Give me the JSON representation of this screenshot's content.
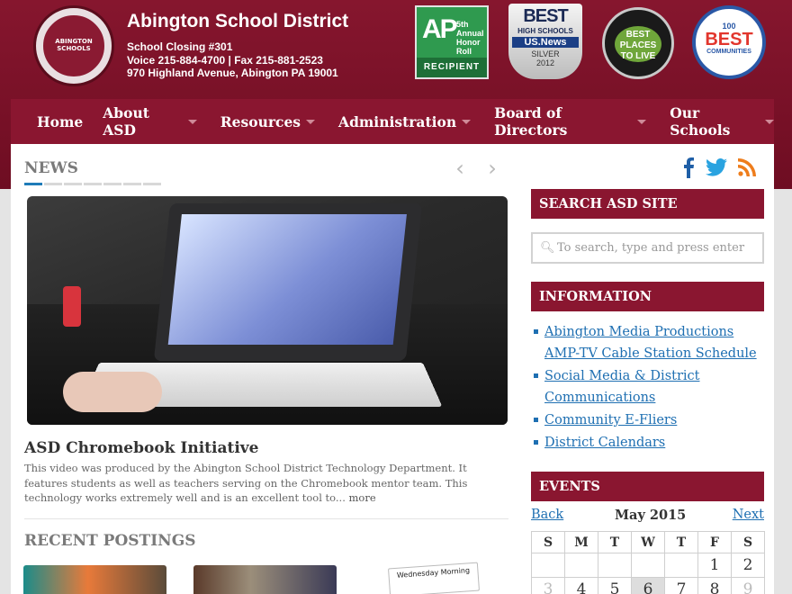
{
  "header": {
    "seal_text": "ABINGTON SCHOOLS",
    "district_name": "Abington School District",
    "closing": "School Closing #301",
    "contact": "Voice 215-884-4700 | Fax 215-881-2523",
    "address": "970 Highland Avenue, Abington PA 19001",
    "badges": {
      "ap": {
        "mark": "AP",
        "text": "5th Annual Honor Roll",
        "label": "RECIPIENT"
      },
      "best": {
        "l1": "BEST",
        "l2": "HIGH SCHOOLS",
        "l3": "US.News",
        "l4": "SILVER",
        "l5": "2012"
      },
      "money": {
        "text": "BEST PLACES TO LIVE"
      },
      "communities": {
        "top": "100",
        "big": "BEST",
        "sub": "COMMUNITIES"
      }
    }
  },
  "nav": {
    "items": [
      {
        "label": "Home",
        "dropdown": false
      },
      {
        "label": "About ASD",
        "dropdown": true
      },
      {
        "label": "Resources",
        "dropdown": true
      },
      {
        "label": "Administration",
        "dropdown": true
      },
      {
        "label": "Board of Directors",
        "dropdown": true
      },
      {
        "label": "Our Schools",
        "dropdown": true
      }
    ]
  },
  "news": {
    "heading": "NEWS",
    "slide_count": 7,
    "active_slide": 0,
    "prev_icon": "chevron-left-icon",
    "next_icon": "chevron-right-icon",
    "featured": {
      "title": "ASD Chromebook Initiative",
      "excerpt": "This video was produced by the Abington School District Technology Department. It features students as well as teachers serving on the Chromebook mentor team. This technology works extremely well and is an excellent tool to...",
      "more": "more"
    }
  },
  "social": {
    "facebook_color": "#1f5fa7",
    "twitter_color": "#2aa3e0",
    "rss_color": "#ee7d1c"
  },
  "recent": {
    "heading": "RECENT POSTINGS",
    "items": [
      {
        "caption": ""
      },
      {
        "caption": ""
      },
      {
        "caption": "Wednesday Morning"
      }
    ]
  },
  "sidebar": {
    "search": {
      "heading": "SEARCH ASD SITE",
      "placeholder": "To search, type and press enter",
      "icon": "magnifier-icon"
    },
    "information": {
      "heading": "INFORMATION",
      "links": [
        "Abington Media Productions AMP-TV Cable Station Schedule",
        "Social Media & District Communications",
        "Community E-Fliers",
        "District Calendars"
      ]
    },
    "events": {
      "heading": "EVENTS",
      "prev": "Back",
      "next": "Next",
      "month": "May  2015",
      "weekdays": [
        "S",
        "M",
        "T",
        "W",
        "T",
        "F",
        "S"
      ],
      "row1": [
        "",
        "",
        "",
        "",
        "",
        "1",
        "2"
      ],
      "row2": [
        "3",
        "4",
        "5",
        "6",
        "7",
        "8",
        "9"
      ],
      "today": "6"
    }
  },
  "colors": {
    "brand": "#8a1630",
    "link": "#1e6fb2",
    "header_bg": "#7d1029"
  }
}
